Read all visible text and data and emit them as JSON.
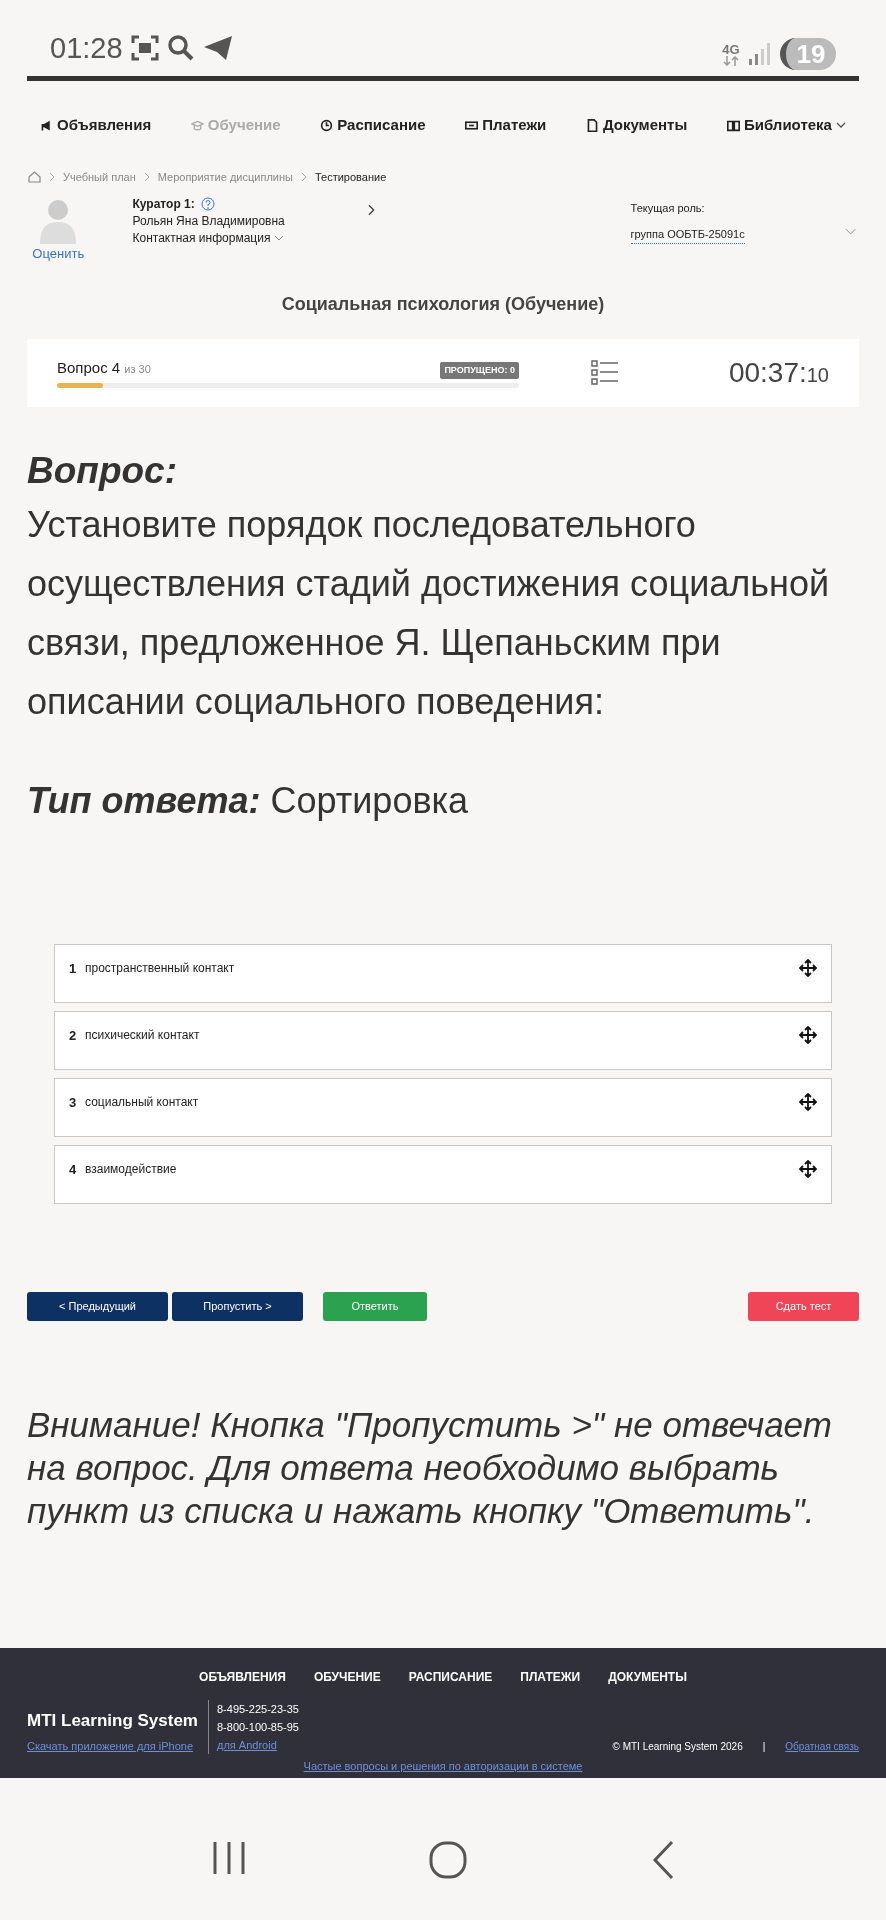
{
  "status_bar": {
    "time": "01:28",
    "network": "4G",
    "battery": "19"
  },
  "nav": [
    {
      "label": "Объявления",
      "selected": false
    },
    {
      "label": "Обучение",
      "selected": true
    },
    {
      "label": "Расписание",
      "selected": false
    },
    {
      "label": "Платежи",
      "selected": false
    },
    {
      "label": "Документы",
      "selected": false
    },
    {
      "label": "Библиотека",
      "selected": false,
      "dropdown": true
    }
  ],
  "breadcrumbs": [
    "Учебный план",
    "Мероприятие дисциплины",
    "Тестирование"
  ],
  "curator": {
    "title": "Куратор 1:",
    "name": "Рольян Яна Владимировна",
    "contact": "Контактная информация",
    "rate": "Оценить"
  },
  "role": {
    "label": "Текущая роль:",
    "value": "группа ООБТБ-25091с"
  },
  "title": "Социальная психология (Обучение)",
  "progress": {
    "label": "Вопрос 4",
    "of": "из 30",
    "skipped": "ПРОПУЩЕНО: 0",
    "level": 0.1,
    "timer_main": "00:37:",
    "timer_sec": "10"
  },
  "question": {
    "heading": "Вопрос:",
    "text": "Установите порядок последовательного осуществления стадий достижения социальной связи, предложенное Я. Щепаньским при описании социального поведения:",
    "type_label": "Тип ответа:",
    "type_value": "Сортировка"
  },
  "items": [
    {
      "number": "1",
      "text": "пространственный контакт"
    },
    {
      "number": "2",
      "text": "психический контакт"
    },
    {
      "number": "3",
      "text": "социальный контакт"
    },
    {
      "number": "4",
      "text": "взаимодействие"
    }
  ],
  "buttons": [
    {
      "label": "< Предыдущий",
      "kind": "navy"
    },
    {
      "label": "Пропустить >",
      "kind": "navy"
    },
    {
      "label": "Ответить",
      "kind": "green"
    },
    {
      "label": "Сдать тест",
      "kind": "red"
    }
  ],
  "warning": "Внимание! Кнопка \"Пропустить >\" не отвечает на вопрос. Для ответа необходимо выбрать пункт из списка и нажать кнопку \"Ответить\".",
  "footer": {
    "links": [
      "ОБЪЯВЛЕНИЯ",
      "ОБУЧЕНИЕ",
      "РАСПИСАНИЕ",
      "ПЛАТЕЖИ",
      "ДОКУМЕНТЫ"
    ],
    "brand": "MTI Learning System",
    "iphone": "Скачать приложение для iPhone",
    "phones": [
      "8-495-225-23-35",
      "8-800-100-85-95"
    ],
    "android": "для Android",
    "copyright": "© MTI Learning System 2026",
    "separator": "|",
    "feedback": "Обратная связь",
    "faq": "Частые вопросы и решения по авторизации в системе"
  }
}
